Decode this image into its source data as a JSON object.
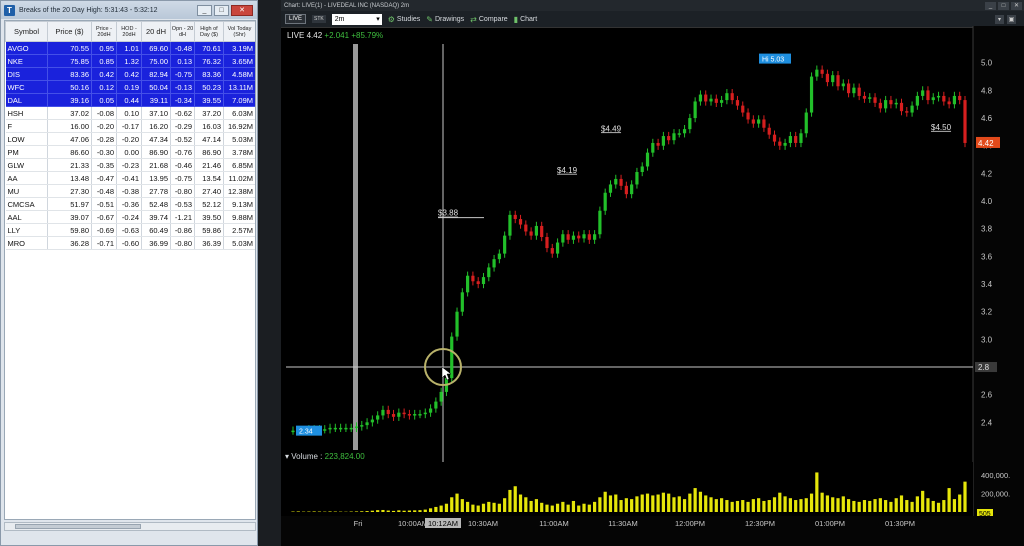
{
  "scanner": {
    "title": "Breaks of the 20 Day High:  5:31:43 - 5:32:12",
    "logo": "T",
    "controls": [
      "_",
      "□",
      "✕"
    ],
    "columns": [
      "Symbol",
      "Price ($)",
      "Price - 20dH",
      "HOD - 20dH",
      "20 dH",
      "Opn - 20 dH",
      "High of Day ($)",
      "Vol Today (Shr)"
    ],
    "rows": [
      {
        "selected": true,
        "cells": [
          "AVGO",
          "70.55",
          "0.95",
          "1.01",
          "69.60",
          "-0.48",
          "70.61",
          "3.19M"
        ]
      },
      {
        "selected": true,
        "cells": [
          "NKE",
          "75.85",
          "0.85",
          "1.32",
          "75.00",
          "0.13",
          "76.32",
          "3.65M"
        ]
      },
      {
        "selected": true,
        "cells": [
          "DIS",
          "83.36",
          "0.42",
          "0.42",
          "82.94",
          "-0.75",
          "83.36",
          "4.58M"
        ]
      },
      {
        "selected": true,
        "cells": [
          "WFC",
          "50.16",
          "0.12",
          "0.19",
          "50.04",
          "-0.13",
          "50.23",
          "13.11M"
        ]
      },
      {
        "selected": true,
        "cells": [
          "DAL",
          "39.16",
          "0.05",
          "0.44",
          "39.11",
          "-0.34",
          "39.55",
          "7.09M"
        ]
      },
      {
        "selected": false,
        "cells": [
          "HSH",
          "37.02",
          "-0.08",
          "0.10",
          "37.10",
          "-0.62",
          "37.20",
          "6.03M"
        ]
      },
      {
        "selected": false,
        "cells": [
          "F",
          "16.00",
          "-0.20",
          "-0.17",
          "16.20",
          "-0.29",
          "16.03",
          "16.92M"
        ]
      },
      {
        "selected": false,
        "cells": [
          "LOW",
          "47.06",
          "-0.28",
          "-0.20",
          "47.34",
          "-0.52",
          "47.14",
          "5.03M"
        ]
      },
      {
        "selected": false,
        "cells": [
          "PM",
          "86.60",
          "-0.30",
          "0.00",
          "86.90",
          "-0.76",
          "86.90",
          "3.78M"
        ]
      },
      {
        "selected": false,
        "cells": [
          "GLW",
          "21.33",
          "-0.35",
          "-0.23",
          "21.68",
          "-0.46",
          "21.46",
          "6.85M"
        ]
      },
      {
        "selected": false,
        "cells": [
          "AA",
          "13.48",
          "-0.47",
          "-0.41",
          "13.95",
          "-0.75",
          "13.54",
          "11.02M"
        ]
      },
      {
        "selected": false,
        "cells": [
          "MU",
          "27.30",
          "-0.48",
          "-0.38",
          "27.78",
          "-0.80",
          "27.40",
          "12.38M"
        ]
      },
      {
        "selected": false,
        "cells": [
          "CMCSA",
          "51.97",
          "-0.51",
          "-0.36",
          "52.48",
          "-0.53",
          "52.12",
          "9.13M"
        ]
      },
      {
        "selected": false,
        "cells": [
          "AAL",
          "39.07",
          "-0.67",
          "-0.24",
          "39.74",
          "-1.21",
          "39.50",
          "9.88M"
        ]
      },
      {
        "selected": false,
        "cells": [
          "LLY",
          "59.80",
          "-0.69",
          "-0.63",
          "60.49",
          "-0.86",
          "59.86",
          "2.57M"
        ]
      },
      {
        "selected": false,
        "cells": [
          "MRO",
          "36.28",
          "-0.71",
          "-0.60",
          "36.99",
          "-0.80",
          "36.39",
          "5.03M"
        ]
      }
    ]
  },
  "chart_window": {
    "title": "Chart: LIVE(1) - LIVEDEAL INC (NASDAQ) 2m",
    "live_button": "LIVE",
    "stk": "STK",
    "timeframe": "2m",
    "toolbar": [
      "Studies",
      "Drawings",
      "Compare",
      "Chart"
    ],
    "quote": {
      "symbol": "LIVE",
      "last": "4.42",
      "change": "+2.041",
      "pct": "+85.79%"
    },
    "volume_label": "Volume :",
    "volume_value": "223,824.00",
    "colors": {
      "up": "#22c02a",
      "down": "#d61f1f",
      "volume": "#e6e60a",
      "crosshair": "#c9c9c9",
      "price_tag": "#e24a1b",
      "hi_tag": "#1e8fe0"
    }
  },
  "chart_data": {
    "type": "candlestick",
    "y_ticks": [
      "5.0",
      "4.8",
      "4.6",
      "4.4",
      "4.2",
      "4.0",
      "3.8",
      "3.6",
      "3.4",
      "3.2",
      "3.0",
      "2.8",
      "2.6",
      "2.4"
    ],
    "x_ticks": [
      "Fri",
      "10:00AM",
      "10:12AM",
      "10:30AM",
      "11:00AM",
      "11:30AM",
      "12:00PM",
      "12:30PM",
      "01:00PM",
      "01:30PM"
    ],
    "volume_ticks": [
      "400,000.",
      "200,000."
    ],
    "volume_label": "505",
    "crosshair_price": "2.8",
    "last_price_tag": "4.42",
    "open_tag": "2.34",
    "high_tag": "Hi 5.03",
    "annotations": [
      "$3.88",
      "$4.19",
      "$4.49",
      "$4.50"
    ],
    "ylim": [
      2.2,
      5.15
    ],
    "closes": [
      2.34,
      2.34,
      2.34,
      2.35,
      2.35,
      2.35,
      2.35,
      2.36,
      2.36,
      2.36,
      2.36,
      2.36,
      2.37,
      2.38,
      2.4,
      2.42,
      2.45,
      2.49,
      2.46,
      2.44,
      2.47,
      2.46,
      2.45,
      2.46,
      2.46,
      2.47,
      2.5,
      2.55,
      2.62,
      2.72,
      3.02,
      3.2,
      3.34,
      3.46,
      3.42,
      3.4,
      3.45,
      3.52,
      3.58,
      3.62,
      3.75,
      3.9,
      3.87,
      3.83,
      3.78,
      3.75,
      3.82,
      3.74,
      3.66,
      3.62,
      3.7,
      3.76,
      3.72,
      3.75,
      3.73,
      3.76,
      3.72,
      3.76,
      3.93,
      4.06,
      4.12,
      4.16,
      4.11,
      4.05,
      4.12,
      4.21,
      4.25,
      4.35,
      4.42,
      4.4,
      4.47,
      4.44,
      4.49,
      4.49,
      4.52,
      4.6,
      4.72,
      4.77,
      4.72,
      4.74,
      4.71,
      4.73,
      4.78,
      4.73,
      4.69,
      4.64,
      4.59,
      4.56,
      4.59,
      4.53,
      4.48,
      4.43,
      4.4,
      4.42,
      4.47,
      4.42,
      4.49,
      4.64,
      4.9,
      4.95,
      4.92,
      4.86,
      4.91,
      4.83,
      4.85,
      4.78,
      4.82,
      4.76,
      4.74,
      4.75,
      4.71,
      4.67,
      4.73,
      4.7,
      4.71,
      4.65,
      4.64,
      4.69,
      4.76,
      4.8,
      4.73,
      4.75,
      4.76,
      4.72,
      4.7,
      4.76,
      4.73,
      4.42
    ],
    "volume_kshr": [
      5,
      6,
      4,
      5,
      6,
      5,
      4,
      6,
      5,
      4,
      3,
      5,
      6,
      8,
      10,
      14,
      20,
      22,
      16,
      12,
      18,
      14,
      16,
      18,
      20,
      26,
      40,
      55,
      70,
      90,
      160,
      200,
      140,
      110,
      80,
      70,
      90,
      110,
      100,
      90,
      150,
      240,
      280,
      190,
      160,
      120,
      140,
      100,
      80,
      70,
      90,
      110,
      80,
      120,
      70,
      90,
      80,
      110,
      160,
      220,
      180,
      190,
      130,
      150,
      140,
      170,
      190,
      200,
      180,
      190,
      210,
      200,
      160,
      170,
      140,
      200,
      260,
      220,
      180,
      160,
      140,
      150,
      130,
      110,
      120,
      130,
      110,
      140,
      150,
      120,
      130,
      160,
      210,
      170,
      150,
      130,
      140,
      150,
      200,
      430,
      210,
      180,
      160,
      150,
      170,
      140,
      120,
      110,
      130,
      120,
      140,
      150,
      130,
      110,
      150,
      180,
      130,
      110,
      170,
      230,
      150,
      120,
      100,
      130,
      260,
      140,
      190,
      330
    ]
  }
}
